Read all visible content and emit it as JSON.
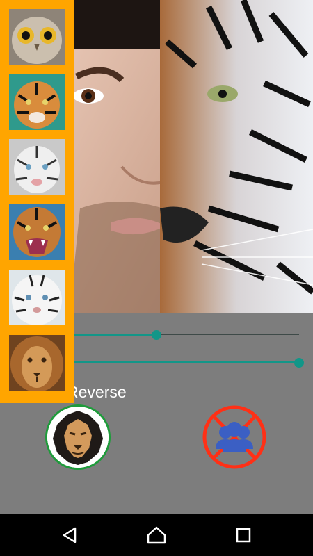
{
  "preview": {
    "icon": "half-human-half-tiger-face-image"
  },
  "thumbnails": [
    {
      "icon": "owl-icon"
    },
    {
      "icon": "tiger-icon"
    },
    {
      "icon": "white-tiger-icon"
    },
    {
      "icon": "roaring-tiger-icon"
    },
    {
      "icon": "white-tiger-closeup-icon"
    },
    {
      "icon": "lion-icon"
    }
  ],
  "sliders": [
    {
      "name": "blend-slider",
      "level": 0.367
    },
    {
      "name": "opacity-slider",
      "level": 1.0
    }
  ],
  "reverse_label": "Reverse",
  "buttons": {
    "lion": {
      "icon": "lion-face-icon"
    },
    "group": {
      "icon": "group-no-icon"
    }
  },
  "navbar": {
    "back": {
      "icon": "back-triangle-icon"
    },
    "home": {
      "icon": "home-icon"
    },
    "recents": {
      "icon": "recents-square-icon"
    }
  },
  "colors": {
    "strip": "#ffa500",
    "accent": "#129688",
    "background": "#7d7d7d",
    "green_ring": "#1f9b3b",
    "red_ring": "#ff3016",
    "group_blue": "#3b5fc4"
  }
}
